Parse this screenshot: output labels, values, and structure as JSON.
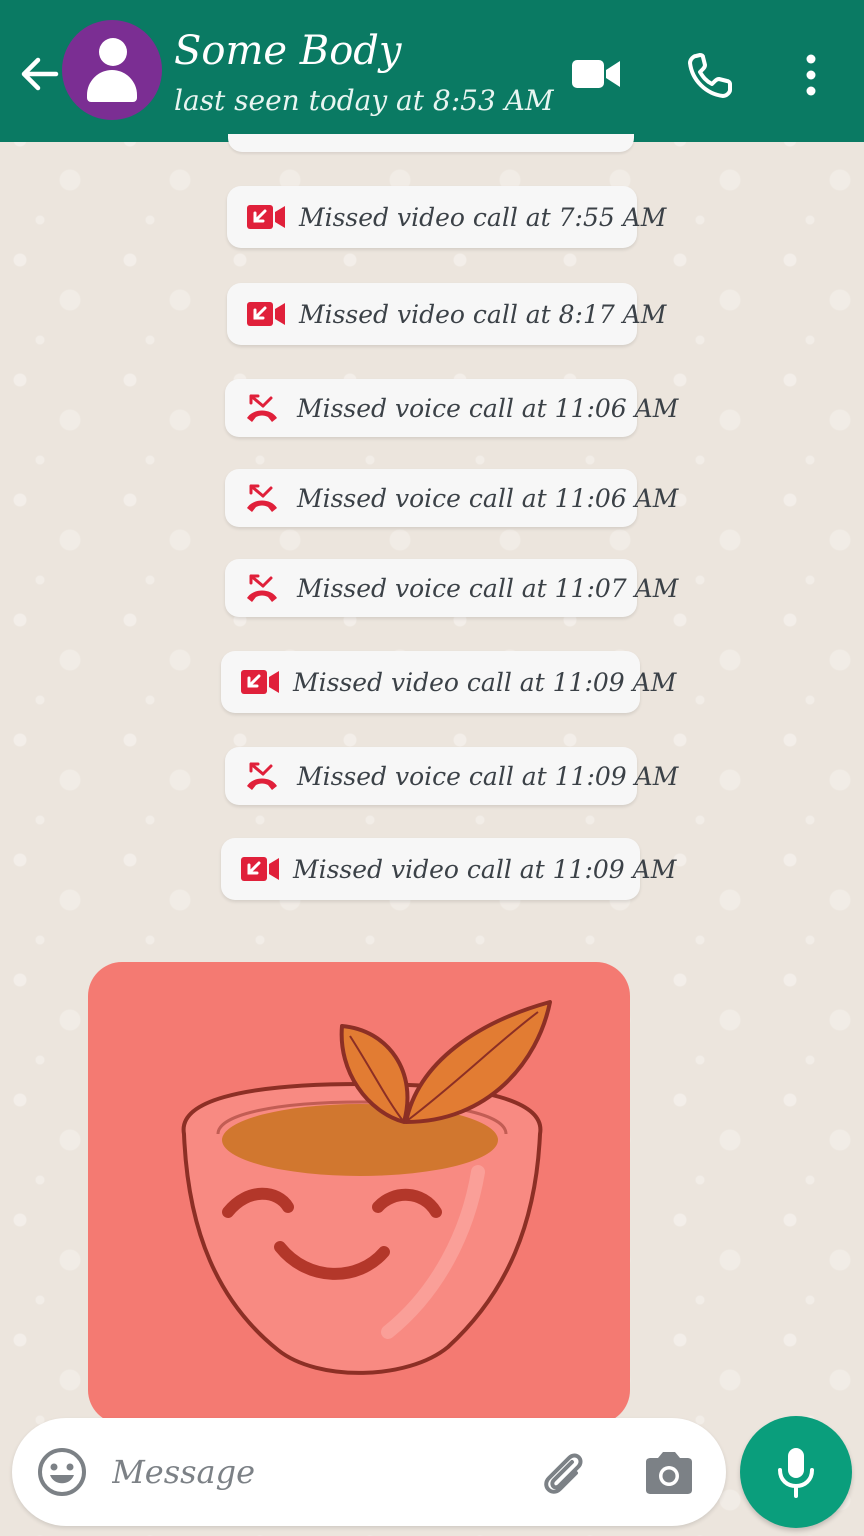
{
  "header": {
    "contact_name": "Some Body",
    "last_seen": "last seen today at 8:53 AM",
    "icons": [
      "back-arrow-icon",
      "avatar",
      "video-call-icon",
      "voice-call-icon",
      "more-options-icon"
    ],
    "color": "#0a7a63"
  },
  "calls": [
    {
      "type": "video",
      "text": "Missed video call at 7:55 AM"
    },
    {
      "type": "video",
      "text": "Missed video call at 8:17 AM"
    },
    {
      "type": "voice",
      "text": "Missed voice call at 11:06 AM"
    },
    {
      "type": "voice",
      "text": "Missed voice call at 11:06 AM"
    },
    {
      "type": "voice",
      "text": "Missed voice call at 11:07 AM"
    },
    {
      "type": "video",
      "text": "Missed video call at 11:09 AM"
    },
    {
      "type": "voice",
      "text": "Missed voice call at 11:09 AM"
    },
    {
      "type": "video",
      "text": "Missed video call at 11:09 AM"
    }
  ],
  "missed_call_color": "#e0203a",
  "sticker": {
    "subject": "smiling-tea-cup-sticker",
    "background": "#f47a72"
  },
  "input": {
    "placeholder": "Message",
    "icons": [
      "emoji-icon",
      "attach-icon",
      "camera-icon",
      "mic-icon"
    ]
  },
  "accent": "#0a9e7c"
}
